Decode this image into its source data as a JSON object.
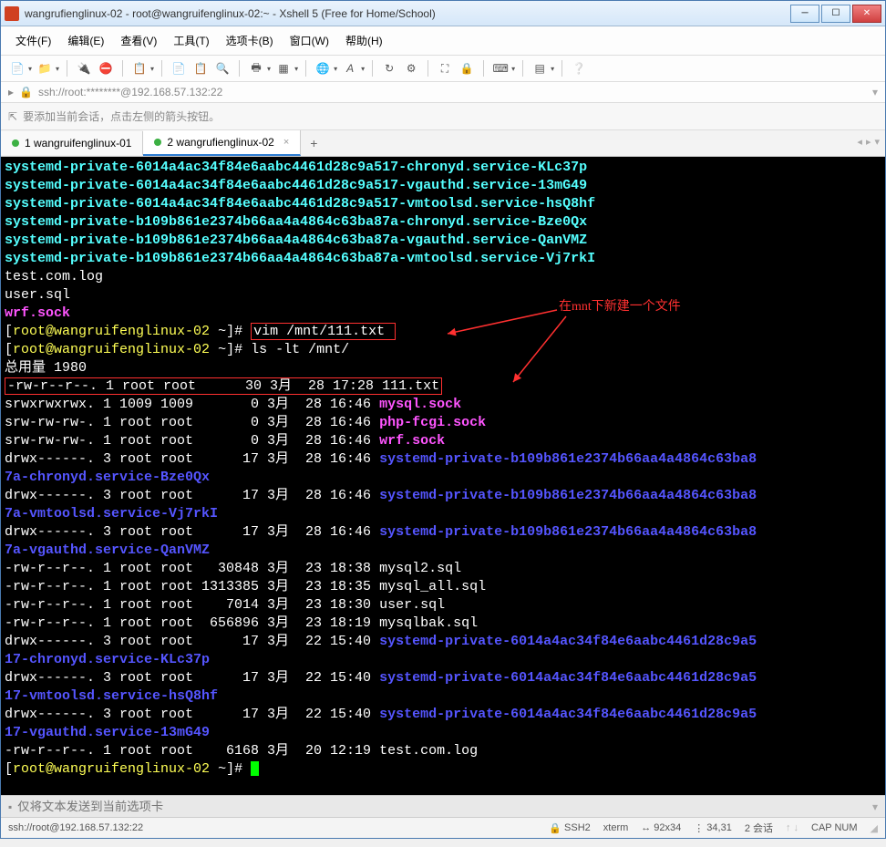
{
  "title": "wangrufienglinux-02 - root@wangruifenglinux-02:~ - Xshell 5 (Free for Home/School)",
  "menu": [
    "文件(F)",
    "编辑(E)",
    "查看(V)",
    "工具(T)",
    "选项卡(B)",
    "窗口(W)",
    "帮助(H)"
  ],
  "address": "ssh://root:********@192.168.57.132:22",
  "hint": "要添加当前会话，点击左侧的箭头按钮。",
  "tabs": [
    {
      "label": "1 wangruifenglinux-01",
      "dot": "#3cb043",
      "active": false
    },
    {
      "label": "2 wangrufienglinux-02",
      "dot": "#3cb043",
      "active": true
    }
  ],
  "annotation": "在mnt下新建一个文件",
  "term": {
    "priv_lines": [
      "systemd-private-6014a4ac34f84e6aabc4461d28c9a517-chronyd.service-KLc37p",
      "systemd-private-6014a4ac34f84e6aabc4461d28c9a517-vgauthd.service-13mG49",
      "systemd-private-6014a4ac34f84e6aabc4461d28c9a517-vmtoolsd.service-hsQ8hf",
      "systemd-private-b109b861e2374b66aa4a4864c63ba87a-chronyd.service-Bze0Qx",
      "systemd-private-b109b861e2374b66aa4a4864c63ba87a-vgauthd.service-QanVMZ",
      "systemd-private-b109b861e2374b66aa4a4864c63ba87a-vmtoolsd.service-Vj7rkI"
    ],
    "plain1": "test.com.log",
    "plain2": "user.sql",
    "sock": "wrf.sock",
    "prompt_user": "root@wangruifenglinux-02",
    "prompt_path": "~",
    "cmd1": "vim /mnt/111.txt",
    "cmd2": "ls -lt /mnt/",
    "total": "总用量 1980",
    "ls": [
      {
        "perm": "-rw-r--r--.",
        "n": "1",
        "u": "root",
        "g": "root",
        "size": "30",
        "mon": "3月",
        "day": "28",
        "time": "17:28",
        "name": "111.txt",
        "color": "",
        "boxed": true
      },
      {
        "perm": "srwxrwxrwx.",
        "n": "1",
        "u": "1009",
        "g": "1009",
        "size": "0",
        "mon": "3月",
        "day": "28",
        "time": "16:46",
        "name": "mysql.sock",
        "color": "c-mag"
      },
      {
        "perm": "srw-rw-rw-.",
        "n": "1",
        "u": "root",
        "g": "root",
        "size": "0",
        "mon": "3月",
        "day": "28",
        "time": "16:46",
        "name": "php-fcgi.sock",
        "color": "c-mag"
      },
      {
        "perm": "srw-rw-rw-.",
        "n": "1",
        "u": "root",
        "g": "root",
        "size": "0",
        "mon": "3月",
        "day": "28",
        "time": "16:46",
        "name": "wrf.sock",
        "color": "c-mag"
      },
      {
        "perm": "drwx------.",
        "n": "3",
        "u": "root",
        "g": "root",
        "size": "17",
        "mon": "3月",
        "day": "28",
        "time": "16:46",
        "name": "systemd-private-b109b861e2374b66aa4a4864c63ba8",
        "color": "c-blue",
        "wrap": "7a-chronyd.service-Bze0Qx"
      },
      {
        "perm": "drwx------.",
        "n": "3",
        "u": "root",
        "g": "root",
        "size": "17",
        "mon": "3月",
        "day": "28",
        "time": "16:46",
        "name": "systemd-private-b109b861e2374b66aa4a4864c63ba8",
        "color": "c-blue",
        "wrap": "7a-vmtoolsd.service-Vj7rkI"
      },
      {
        "perm": "drwx------.",
        "n": "3",
        "u": "root",
        "g": "root",
        "size": "17",
        "mon": "3月",
        "day": "28",
        "time": "16:46",
        "name": "systemd-private-b109b861e2374b66aa4a4864c63ba8",
        "color": "c-blue",
        "wrap": "7a-vgauthd.service-QanVMZ"
      },
      {
        "perm": "-rw-r--r--.",
        "n": "1",
        "u": "root",
        "g": "root",
        "size": "30848",
        "mon": "3月",
        "day": "23",
        "time": "18:38",
        "name": "mysql2.sql",
        "color": ""
      },
      {
        "perm": "-rw-r--r--.",
        "n": "1",
        "u": "root",
        "g": "root",
        "size": "1313385",
        "mon": "3月",
        "day": "23",
        "time": "18:35",
        "name": "mysql_all.sql",
        "color": ""
      },
      {
        "perm": "-rw-r--r--.",
        "n": "1",
        "u": "root",
        "g": "root",
        "size": "7014",
        "mon": "3月",
        "day": "23",
        "time": "18:30",
        "name": "user.sql",
        "color": ""
      },
      {
        "perm": "-rw-r--r--.",
        "n": "1",
        "u": "root",
        "g": "root",
        "size": "656896",
        "mon": "3月",
        "day": "23",
        "time": "18:19",
        "name": "mysqlbak.sql",
        "color": ""
      },
      {
        "perm": "drwx------.",
        "n": "3",
        "u": "root",
        "g": "root",
        "size": "17",
        "mon": "3月",
        "day": "22",
        "time": "15:40",
        "name": "systemd-private-6014a4ac34f84e6aabc4461d28c9a5",
        "color": "c-blue",
        "wrap": "17-chronyd.service-KLc37p"
      },
      {
        "perm": "drwx------.",
        "n": "3",
        "u": "root",
        "g": "root",
        "size": "17",
        "mon": "3月",
        "day": "22",
        "time": "15:40",
        "name": "systemd-private-6014a4ac34f84e6aabc4461d28c9a5",
        "color": "c-blue",
        "wrap": "17-vmtoolsd.service-hsQ8hf"
      },
      {
        "perm": "drwx------.",
        "n": "3",
        "u": "root",
        "g": "root",
        "size": "17",
        "mon": "3月",
        "day": "22",
        "time": "15:40",
        "name": "systemd-private-6014a4ac34f84e6aabc4461d28c9a5",
        "color": "c-blue",
        "wrap": "17-vgauthd.service-13mG49"
      },
      {
        "perm": "-rw-r--r--.",
        "n": "1",
        "u": "root",
        "g": "root",
        "size": "6168",
        "mon": "3月",
        "day": "20",
        "time": "12:19",
        "name": "test.com.log",
        "color": ""
      }
    ]
  },
  "sendbar_placeholder": "仅将文本发送到当前选项卡",
  "status": {
    "conn": "ssh://root@192.168.57.132:22",
    "proto": "SSH2",
    "term": "xterm",
    "size": "92x34",
    "pos": "34,31",
    "sess": "2 会话",
    "caps": "CAP  NUM"
  }
}
